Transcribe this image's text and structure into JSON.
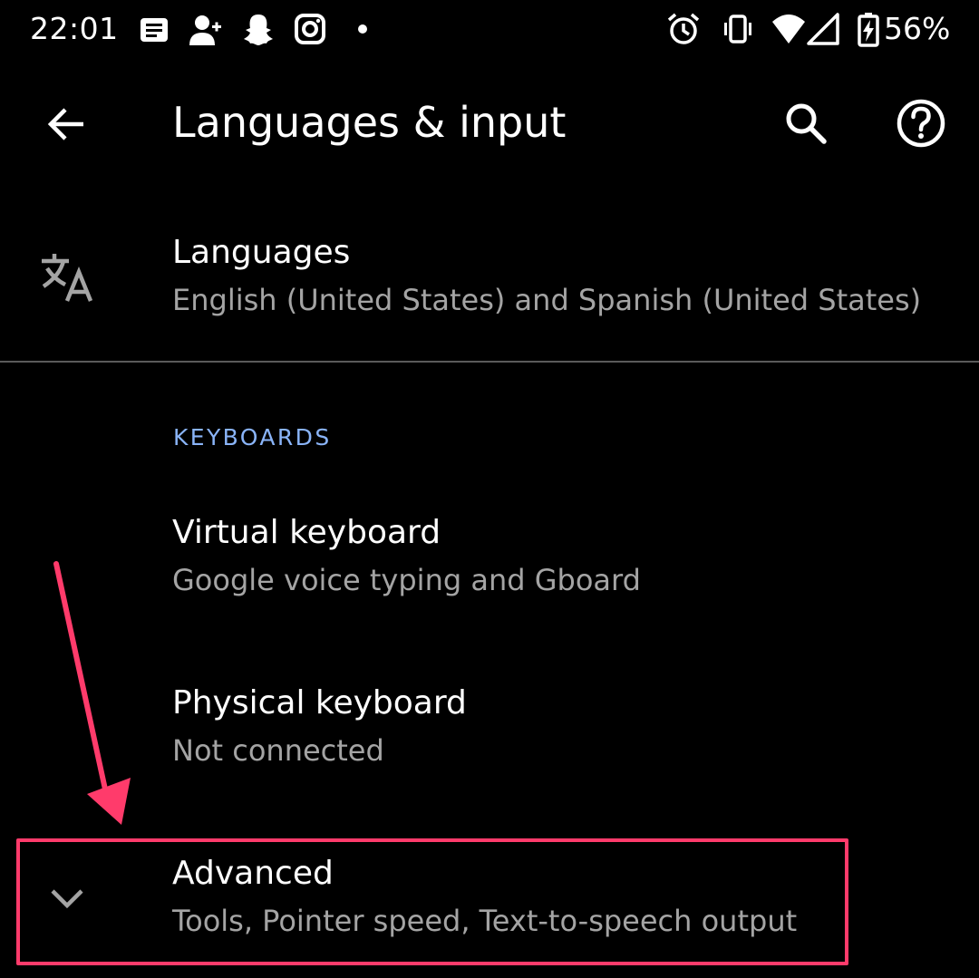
{
  "status_bar": {
    "time": "22:01",
    "battery": "56%",
    "left_icons": [
      "message-icon",
      "add-contact-icon",
      "snapchat-icon",
      "instagram-icon",
      "dot-icon"
    ],
    "right_icons": [
      "alarm-icon",
      "vibrate-icon",
      "wifi-icon",
      "cell-signal-icon",
      "battery-charging-icon"
    ]
  },
  "app_bar": {
    "title": "Languages & input",
    "back_icon": "back-arrow-icon",
    "search_icon": "search-icon",
    "help_icon": "help-icon"
  },
  "languages": {
    "icon": "translate-icon",
    "title": "Languages",
    "summary": "English (United States) and Spanish (United States)"
  },
  "keyboards_section": {
    "header": "KEYBOARDS",
    "items": [
      {
        "title": "Virtual keyboard",
        "summary": "Google voice typing and Gboard"
      },
      {
        "title": "Physical keyboard",
        "summary": "Not connected"
      }
    ]
  },
  "advanced": {
    "icon": "chevron-down-icon",
    "title": "Advanced",
    "summary": "Tools, Pointer speed, Text-to-speech output"
  },
  "colors": {
    "background": "#000000",
    "text_primary": "#ffffff",
    "text_secondary": "#a4a4a4",
    "section_header": "#8ab4f8",
    "annotation": "#ff3b6b"
  }
}
